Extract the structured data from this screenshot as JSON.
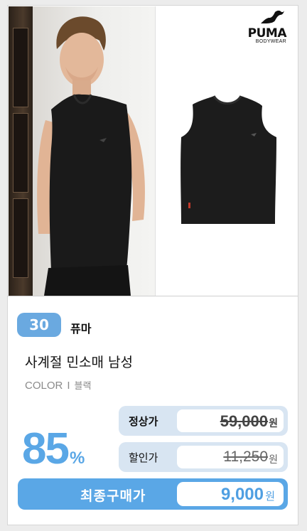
{
  "product": {
    "rank": "30",
    "brand": "퓨마",
    "name": "사계절 민소매 남성",
    "color_label": "COLOR",
    "color_separator": "I",
    "color_value": "블랙"
  },
  "logo": {
    "word": "PUMA",
    "sub": "BODYWEAR"
  },
  "discount": {
    "percent": "85",
    "symbol": "%"
  },
  "prices": {
    "regular_label": "정상가",
    "regular_amount": "59,000",
    "sale_label": "할인가",
    "sale_amount": "11,250",
    "final_label": "최종구매가",
    "final_amount": "9,000",
    "currency": "원"
  },
  "colors": {
    "accent": "#5aa7e6",
    "badge": "#6aa9e0",
    "price_row_bg": "#d8e5f2"
  }
}
